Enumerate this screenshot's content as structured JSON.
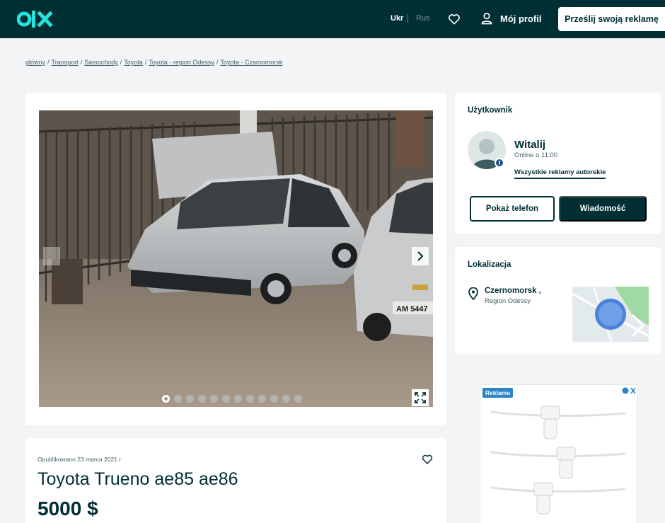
{
  "header": {
    "lang_ukr": "Ukr",
    "lang_sep": "|",
    "lang_rus": "Rus",
    "profile_label": "Mój profil",
    "post_button": "Prześlij swoją reklamę",
    "brand_color": "#002f34",
    "logo_color": "#23e5db"
  },
  "breadcrumb": [
    "główny",
    "Transport",
    "Samochody",
    "Toyota",
    "Toyota - region Odessy",
    "Toyota - Czarnomorsk"
  ],
  "breadcrumb_separator": "/",
  "gallery": {
    "photo_count": 12,
    "active_index": 0,
    "plate_text": "AM 5447"
  },
  "listing": {
    "published": "Opublikowano 23 marca 2021 r",
    "title": "Toyota Trueno ae85 ae86",
    "price": "5000 $"
  },
  "user": {
    "section_title": "Użytkownik",
    "name": "Witalij",
    "online": "Online o 11:00",
    "all_ads_link": "Wszystkie reklamy autorskie",
    "show_phone": "Pokaż telefon",
    "message": "Wiadomość",
    "social_badge": "f"
  },
  "location": {
    "section_title": "Lokalizacja",
    "city": "Czernomorsk ,",
    "region": "Region Odessy"
  },
  "advert": {
    "label": "Reklama"
  },
  "icons": {
    "heart": "heart-icon",
    "user": "user-icon",
    "arrow_left": "chevron-left-icon",
    "arrow_right": "chevron-right-icon",
    "fullscreen": "fullscreen-icon",
    "pin": "location-pin-icon"
  }
}
